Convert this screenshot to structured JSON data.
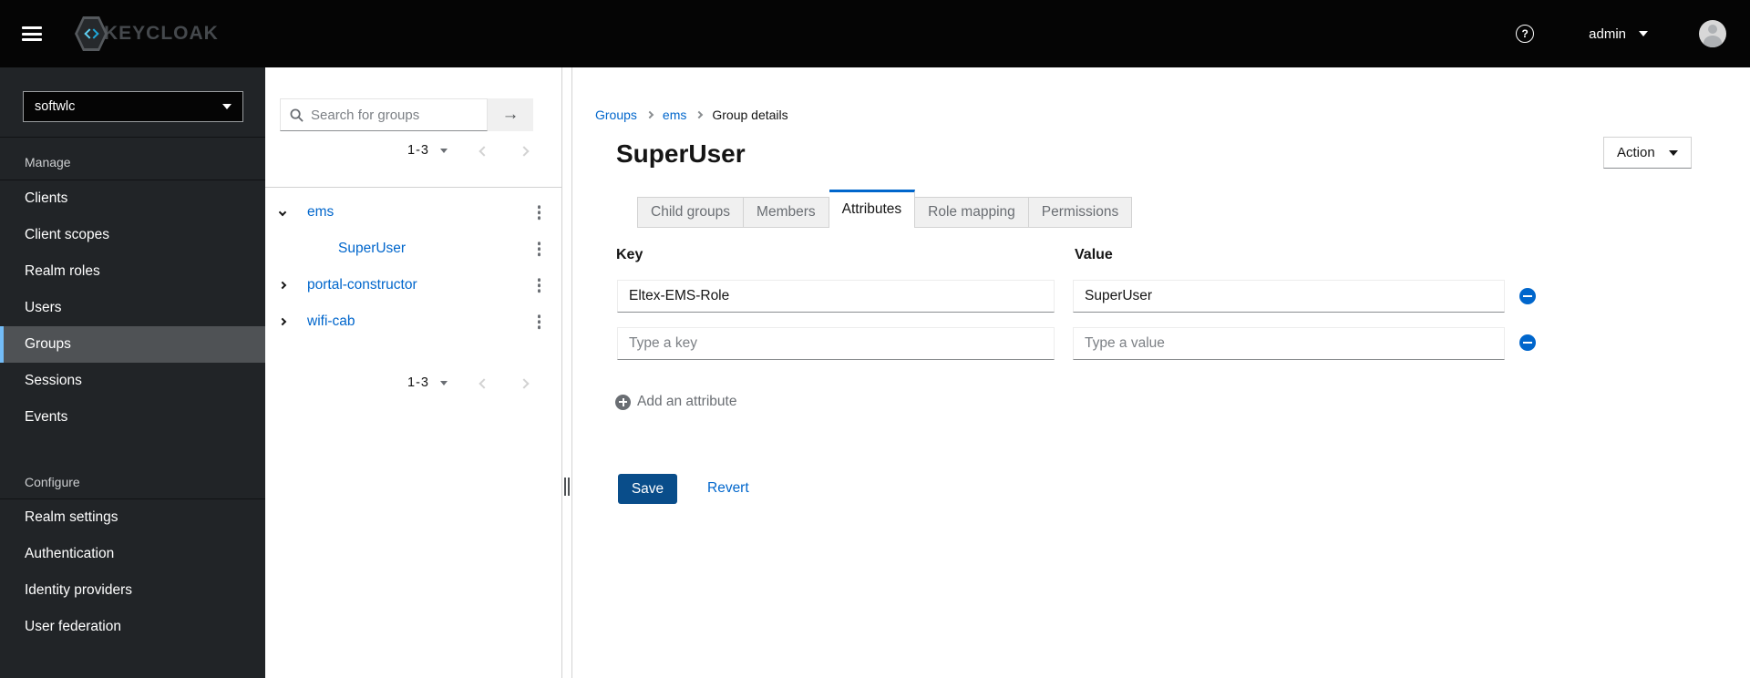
{
  "masthead": {
    "brand": "KEYCLOAK",
    "help_glyph": "?",
    "username": "admin"
  },
  "sidebar": {
    "realm": "softwlc",
    "sections": [
      {
        "label": "Manage",
        "items": [
          {
            "label": "Clients"
          },
          {
            "label": "Client scopes"
          },
          {
            "label": "Realm roles"
          },
          {
            "label": "Users"
          },
          {
            "label": "Groups",
            "active": true
          },
          {
            "label": "Sessions"
          },
          {
            "label": "Events"
          }
        ]
      },
      {
        "label": "Configure",
        "items": [
          {
            "label": "Realm settings"
          },
          {
            "label": "Authentication"
          },
          {
            "label": "Identity providers"
          },
          {
            "label": "User federation"
          }
        ]
      }
    ]
  },
  "tree_panel": {
    "search_placeholder": "Search for groups",
    "search_submit_glyph": "→",
    "pager": {
      "range": "1-3"
    },
    "items": [
      {
        "label": "ems",
        "level": 0,
        "expanded": true
      },
      {
        "label": "SuperUser",
        "level": 1
      },
      {
        "label": "portal-constructor",
        "level": 0,
        "expanded": false
      },
      {
        "label": "wifi-cab",
        "level": 0,
        "expanded": false
      }
    ]
  },
  "main": {
    "breadcrumb": [
      {
        "label": "Groups",
        "link": true
      },
      {
        "label": "ems",
        "link": true
      },
      {
        "label": "Group details",
        "link": false
      }
    ],
    "title": "SuperUser",
    "action_button": "Action",
    "tabs": [
      {
        "label": "Child groups"
      },
      {
        "label": "Members"
      },
      {
        "label": "Attributes",
        "active": true
      },
      {
        "label": "Role mapping"
      },
      {
        "label": "Permissions"
      }
    ],
    "attributes": {
      "key_header": "Key",
      "value_header": "Value",
      "rows": [
        {
          "key": "Eltex-EMS-Role",
          "value": "SuperUser"
        },
        {
          "key": "",
          "key_placeholder": "Type a key",
          "value": "",
          "value_placeholder": "Type a value"
        }
      ],
      "add_button": "Add an attribute"
    },
    "save_button": "Save",
    "revert_button": "Revert"
  },
  "colors": {
    "link_blue": "#0066cc",
    "tab_active_accent": "#0066cc",
    "save_button_bg": "#094d8a",
    "nav_active_accent": "#73bcf7",
    "masthead_bg": "#050505",
    "sidebar_bg": "#212427"
  }
}
